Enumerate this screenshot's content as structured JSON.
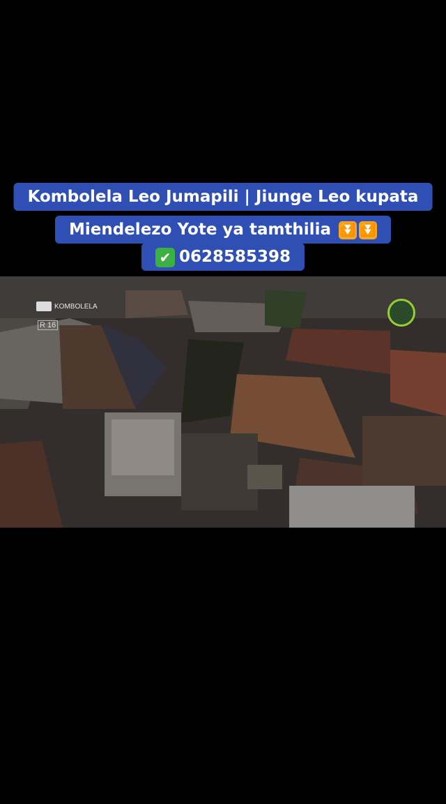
{
  "caption": {
    "line1": "Kombolela Leo Jumapili | Jiunge Leo kupata",
    "line2": "Miendelezo Yote ya tamthilia",
    "arrow_icon": "double-down-arrow-emoji",
    "check_icon": "check-mark-emoji",
    "phone": "0628585398",
    "background_color": "#2f4fb4"
  },
  "video": {
    "watermark_text": "KOMBOLELA",
    "rating_text": "R 16"
  }
}
